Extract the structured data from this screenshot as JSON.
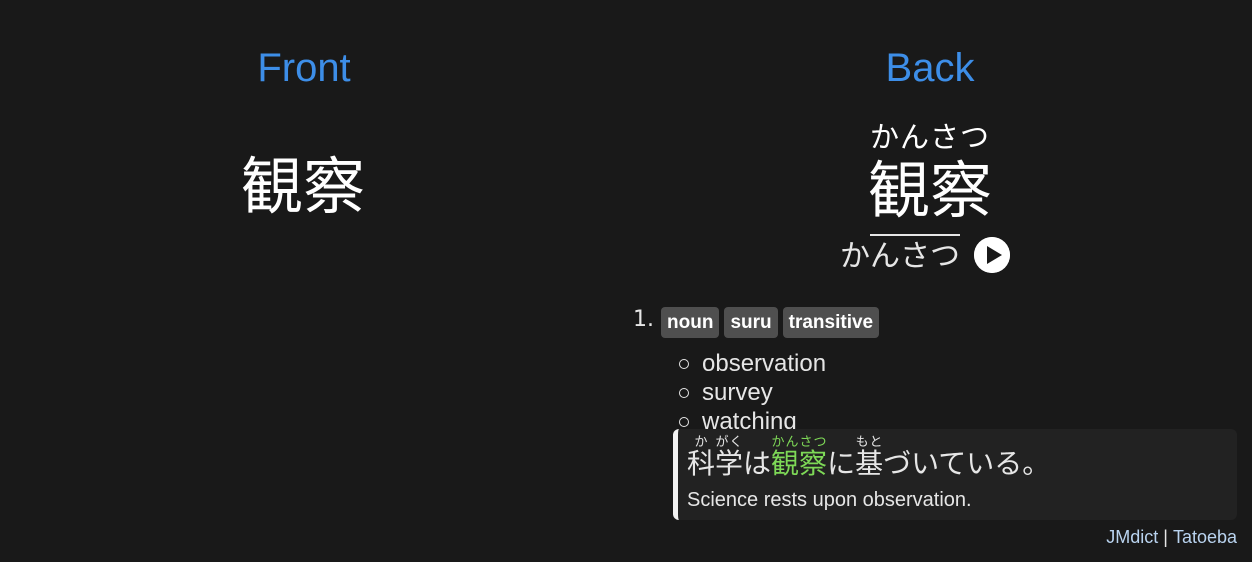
{
  "front": {
    "title": "Front",
    "word": "観察"
  },
  "back": {
    "title": "Back",
    "reading": "かんさつ",
    "word": "観察",
    "pitch": {
      "low_part": "か",
      "high_part": "んさつ"
    },
    "audio_icon": "play-icon"
  },
  "senses": [
    {
      "number": "1.",
      "tags": [
        "noun",
        "suru",
        "transitive"
      ],
      "glosses": [
        "observation",
        "survey",
        "watching"
      ]
    }
  ],
  "example": {
    "segments": [
      {
        "base": "科",
        "ruby": "か"
      },
      {
        "base": "学",
        "ruby": "がく"
      },
      {
        "base": "は",
        "ruby": ""
      },
      {
        "base": "観察",
        "ruby": "かんさつ",
        "highlight": true
      },
      {
        "base": "に",
        "ruby": ""
      },
      {
        "base": "基",
        "ruby": "もと"
      },
      {
        "base": "づいている。",
        "ruby": ""
      }
    ],
    "translation": "Science rests upon observation."
  },
  "sources": {
    "jmdict": "JMdict",
    "separator": "|",
    "tatoeba": "Tatoeba"
  },
  "colors": {
    "background": "#191919",
    "title_accent": "#3d8ee8",
    "tag_background": "#4f4f4f",
    "highlight": "#7ed957",
    "source_link": "#b9d3ef"
  }
}
